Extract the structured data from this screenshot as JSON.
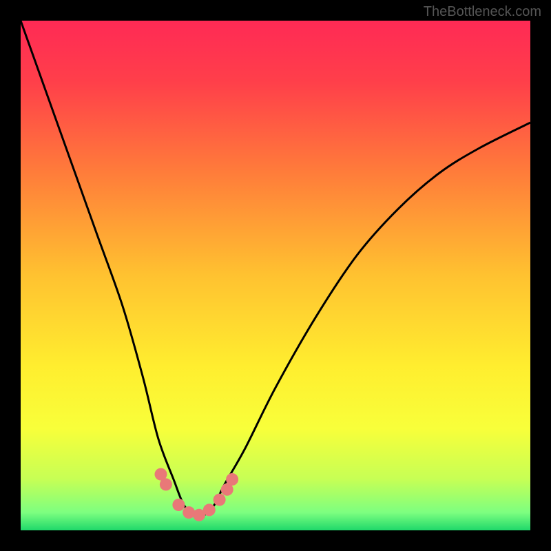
{
  "watermark": "TheBottleneck.com",
  "chart_data": {
    "type": "line",
    "title": "",
    "xlabel": "",
    "ylabel": "",
    "xlim": [
      0,
      100
    ],
    "ylim": [
      0,
      100
    ],
    "grid": false,
    "legend": false,
    "series": [
      {
        "name": "bottleneck-curve",
        "x": [
          0,
          5,
          10,
          15,
          20,
          24,
          27,
          30,
          32,
          34,
          36,
          38,
          40,
          44,
          50,
          58,
          66,
          74,
          82,
          90,
          100
        ],
        "y": [
          100,
          86,
          72,
          58,
          44,
          30,
          18,
          10,
          5,
          3,
          3,
          5,
          9,
          16,
          28,
          42,
          54,
          63,
          70,
          75,
          80
        ]
      }
    ],
    "markers": {
      "name": "highlighted-dots",
      "color": "#e97878",
      "points": [
        {
          "x": 27.5,
          "y": 11
        },
        {
          "x": 28.5,
          "y": 9
        },
        {
          "x": 31,
          "y": 5
        },
        {
          "x": 33,
          "y": 3.5
        },
        {
          "x": 35,
          "y": 3
        },
        {
          "x": 37,
          "y": 4
        },
        {
          "x": 39,
          "y": 6
        },
        {
          "x": 40.5,
          "y": 8
        },
        {
          "x": 41.5,
          "y": 10
        }
      ]
    },
    "gradient_stops": [
      {
        "offset": 0.0,
        "color": "#ff2a55"
      },
      {
        "offset": 0.12,
        "color": "#ff3f4a"
      },
      {
        "offset": 0.3,
        "color": "#ff7d3a"
      },
      {
        "offset": 0.5,
        "color": "#ffc230"
      },
      {
        "offset": 0.68,
        "color": "#ffee2f"
      },
      {
        "offset": 0.8,
        "color": "#f8ff3a"
      },
      {
        "offset": 0.9,
        "color": "#c6ff55"
      },
      {
        "offset": 0.965,
        "color": "#7dff80"
      },
      {
        "offset": 1.0,
        "color": "#1fd86a"
      }
    ]
  }
}
